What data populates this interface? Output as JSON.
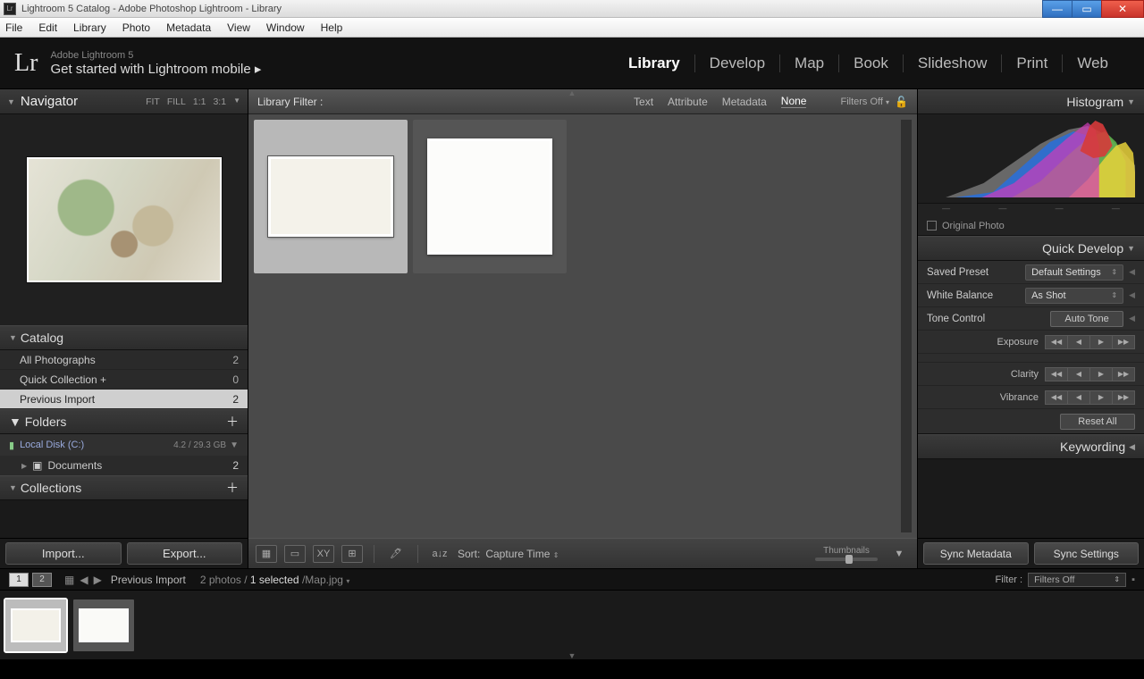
{
  "window_title": "Lightroom 5 Catalog - Adobe Photoshop Lightroom - Library",
  "menubar": [
    "File",
    "Edit",
    "Library",
    "Photo",
    "Metadata",
    "View",
    "Window",
    "Help"
  ],
  "logo": "Lr",
  "brand_line1": "Adobe Lightroom 5",
  "brand_line2": "Get started with Lightroom mobile  ▸",
  "modules": [
    "Library",
    "Develop",
    "Map",
    "Book",
    "Slideshow",
    "Print",
    "Web"
  ],
  "active_module": "Library",
  "navigator": {
    "title": "Navigator",
    "zoom": [
      "FIT",
      "FILL",
      "1:1",
      "3:1"
    ]
  },
  "catalog": {
    "title": "Catalog",
    "items": [
      {
        "label": "All Photographs",
        "count": 2
      },
      {
        "label": "Quick Collection  +",
        "count": 0
      },
      {
        "label": "Previous Import",
        "count": 2,
        "selected": true
      }
    ]
  },
  "folders": {
    "title": "Folders",
    "volume": {
      "label": "Local Disk (C:)",
      "size": "4.2 / 29.3 GB"
    },
    "items": [
      {
        "label": "Documents",
        "count": 2
      }
    ]
  },
  "collections_title": "Collections",
  "import_label": "Import...",
  "export_label": "Export...",
  "filter": {
    "label": "Library Filter :",
    "tabs": [
      "Text",
      "Attribute",
      "Metadata",
      "None"
    ],
    "active": "None",
    "state": "Filters Off"
  },
  "toolbar": {
    "sort_label": "Sort:",
    "sort_value": "Capture Time",
    "thumbs_label": "Thumbnails"
  },
  "histogram_title": "Histogram",
  "original_photo": "Original Photo",
  "quick_develop": {
    "title": "Quick Develop",
    "saved_preset": {
      "label": "Saved Preset",
      "value": "Default Settings"
    },
    "white_balance": {
      "label": "White Balance",
      "value": "As Shot"
    },
    "tone_control": {
      "label": "Tone Control",
      "auto": "Auto Tone"
    },
    "exposure": "Exposure",
    "clarity": "Clarity",
    "vibrance": "Vibrance",
    "reset": "Reset All"
  },
  "keywording_title": "Keywording",
  "sync_metadata": "Sync Metadata",
  "sync_settings": "Sync Settings",
  "status": {
    "source": "Previous Import",
    "count": "2 photos /",
    "selected": "1 selected",
    "file": "/Map.jpg",
    "filter_label": "Filter :",
    "filter_value": "Filters Off"
  }
}
